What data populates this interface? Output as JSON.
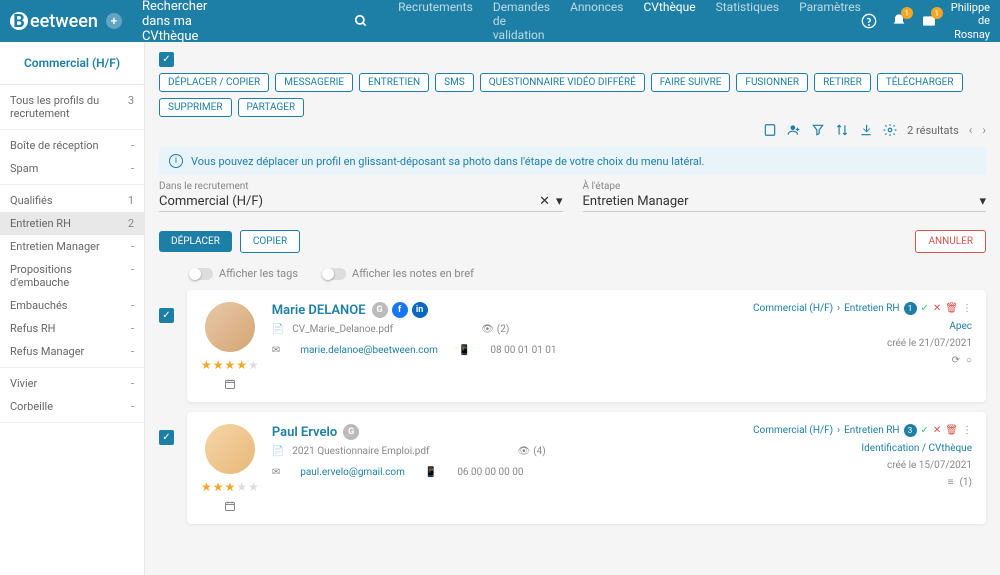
{
  "header": {
    "brand": "eetween",
    "search_title": "Rechercher dans ma CVthèque",
    "nav": [
      "Recrutements",
      "Demandes de validation",
      "Annonces",
      "CVthèque",
      "Statistiques",
      "Paramètres"
    ],
    "notif_badge": "1",
    "msg_badge": "1",
    "user_line1": "Philippe",
    "user_line2": "de Rosnay"
  },
  "sidebar": {
    "title": "Commercial (H/F)",
    "sections": [
      [
        {
          "label": "Tous les profils du recrutement",
          "count": "3"
        }
      ],
      [
        {
          "label": "Boîte de réception",
          "count": "-"
        },
        {
          "label": "Spam",
          "count": "-"
        }
      ],
      [
        {
          "label": "Qualifiés",
          "count": "1"
        },
        {
          "label": "Entretien RH",
          "count": "2",
          "selected": true
        },
        {
          "label": "Entretien Manager",
          "count": "-"
        },
        {
          "label": "Propositions d'embauche",
          "count": "-"
        },
        {
          "label": "Embauchés",
          "count": "-"
        },
        {
          "label": "Refus RH",
          "count": "-"
        },
        {
          "label": "Refus Manager",
          "count": "-"
        }
      ],
      [
        {
          "label": "Vivier",
          "count": "-"
        },
        {
          "label": "Corbeille",
          "count": "-"
        }
      ]
    ]
  },
  "actions": [
    "DÉPLACER / COPIER",
    "MESSAGERIE",
    "ENTRETIEN",
    "SMS",
    "QUESTIONNAIRE VIDÉO DIFFÉRÉ",
    "FAIRE SUIVRE",
    "FUSIONNER",
    "RETIRER",
    "TÉLÉCHARGER",
    "SUPPRIMER",
    "PARTAGER"
  ],
  "results_text": "2 résultats",
  "info_text": "Vous pouvez déplacer un profil en glissant-déposant sa photo dans l'étape de votre choix du menu latéral.",
  "move": {
    "label1": "Dans le recrutement",
    "value1": "Commercial (H/F)",
    "label2": "À l'étape",
    "value2": "Entretien Manager"
  },
  "buttons": {
    "move": "DÉPLACER",
    "copy": "COPIER",
    "cancel": "ANNULER"
  },
  "toggles": {
    "tags": "Afficher les tags",
    "notes": "Afficher les notes en bref"
  },
  "candidates": [
    {
      "name": "Marie DELANOE",
      "doc": "CV_Marie_Delanoe.pdf",
      "views": "(2)",
      "email": "marie.delanoe@beetween.com",
      "phone": "08 00 01 01 01",
      "stars_full": 4,
      "social": [
        "g",
        "f",
        "l"
      ],
      "crumb_campaign": "Commercial (H/F)",
      "crumb_step": "Entretien RH",
      "crumb_badge": "1",
      "source": "Apec",
      "created": "créé le 21/07/2021",
      "extra_icons": "sync"
    },
    {
      "name": "Paul Ervelo",
      "doc": "2021 Questionnaire Emploi.pdf",
      "views": "(4)",
      "email": "paul.ervelo@gmail.com",
      "phone": "06 00 00 00 00",
      "stars_full": 3,
      "social": [
        "g"
      ],
      "crumb_campaign": "Commercial (H/F)",
      "crumb_step": "Entretien RH",
      "crumb_badge": "3",
      "source": "Identification / CVthèque",
      "created": "créé le 15/07/2021",
      "extra_text": "(1)"
    }
  ]
}
